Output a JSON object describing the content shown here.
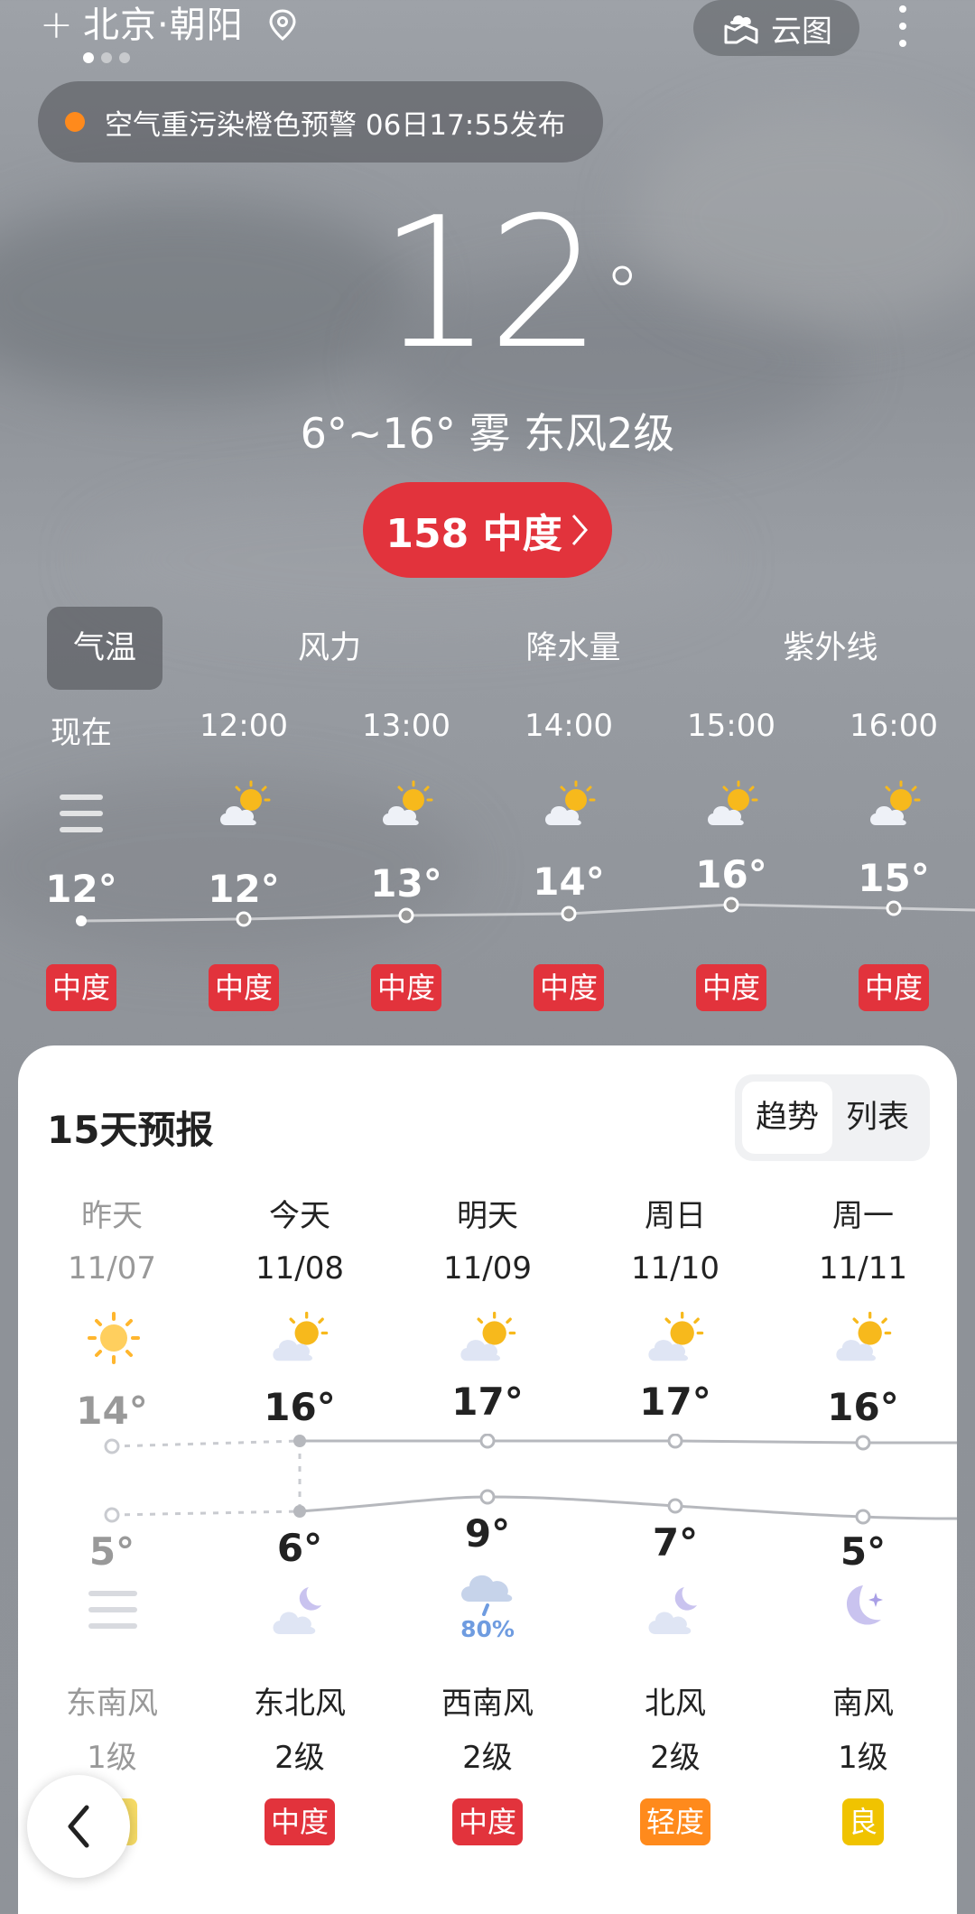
{
  "header": {
    "plus": "+",
    "city": "北京·朝阳",
    "cloud_map_label": "云图"
  },
  "alert": {
    "text": "空气重污染橙色预警 06日17:55发布",
    "color": "#ff8a1c"
  },
  "current": {
    "temperature": "12",
    "degree": "°",
    "summary": "6°~16° 雾 东风2级",
    "aqi_label": "158 中度",
    "aqi_color": "#e2333c"
  },
  "tabs": [
    "气温",
    "风力",
    "降水量",
    "紫外线"
  ],
  "hourly": [
    {
      "time": "现在",
      "icon": "fog-icon",
      "temp": "12°",
      "aqi": "中度"
    },
    {
      "time": "12:00",
      "icon": "partly-cloudy-icon",
      "temp": "12°",
      "aqi": "中度"
    },
    {
      "time": "13:00",
      "icon": "partly-cloudy-icon",
      "temp": "13°",
      "aqi": "中度"
    },
    {
      "time": "14:00",
      "icon": "partly-cloudy-icon",
      "temp": "14°",
      "aqi": "中度"
    },
    {
      "time": "15:00",
      "icon": "partly-cloudy-icon",
      "temp": "16°",
      "aqi": "中度"
    },
    {
      "time": "16:00",
      "icon": "partly-cloudy-icon",
      "temp": "15°",
      "aqi": "中度"
    }
  ],
  "forecast": {
    "title": "15天预报",
    "seg_trend": "趋势",
    "seg_list": "列表",
    "days": [
      {
        "name": "昨天",
        "date": "11/07",
        "day_icon": "sunny-icon",
        "high": "14°",
        "low": "5°",
        "night_icon": "fog-icon",
        "precip": "",
        "wind_dir": "东南风",
        "wind_level": "1级",
        "aqi": "",
        "aqi_color": "#f0c300"
      },
      {
        "name": "今天",
        "date": "11/08",
        "day_icon": "partly-cloudy-icon",
        "high": "16°",
        "low": "6°",
        "night_icon": "cloudy-night-icon",
        "precip": "",
        "wind_dir": "东北风",
        "wind_level": "2级",
        "aqi": "中度",
        "aqi_color": "#e2333c"
      },
      {
        "name": "明天",
        "date": "11/09",
        "day_icon": "partly-cloudy-icon",
        "high": "17°",
        "low": "9°",
        "night_icon": "rain-icon",
        "precip": "80%",
        "wind_dir": "西南风",
        "wind_level": "2级",
        "aqi": "中度",
        "aqi_color": "#e2333c"
      },
      {
        "name": "周日",
        "date": "11/10",
        "day_icon": "partly-cloudy-icon",
        "high": "17°",
        "low": "7°",
        "night_icon": "cloudy-night-icon",
        "precip": "",
        "wind_dir": "北风",
        "wind_level": "2级",
        "aqi": "轻度",
        "aqi_color": "#ff8a1c"
      },
      {
        "name": "周一",
        "date": "11/11",
        "day_icon": "partly-cloudy-icon",
        "high": "16°",
        "low": "5°",
        "night_icon": "clear-night-icon",
        "precip": "",
        "wind_dir": "南风",
        "wind_level": "1级",
        "aqi": "良",
        "aqi_color": "#f0c300"
      }
    ]
  }
}
